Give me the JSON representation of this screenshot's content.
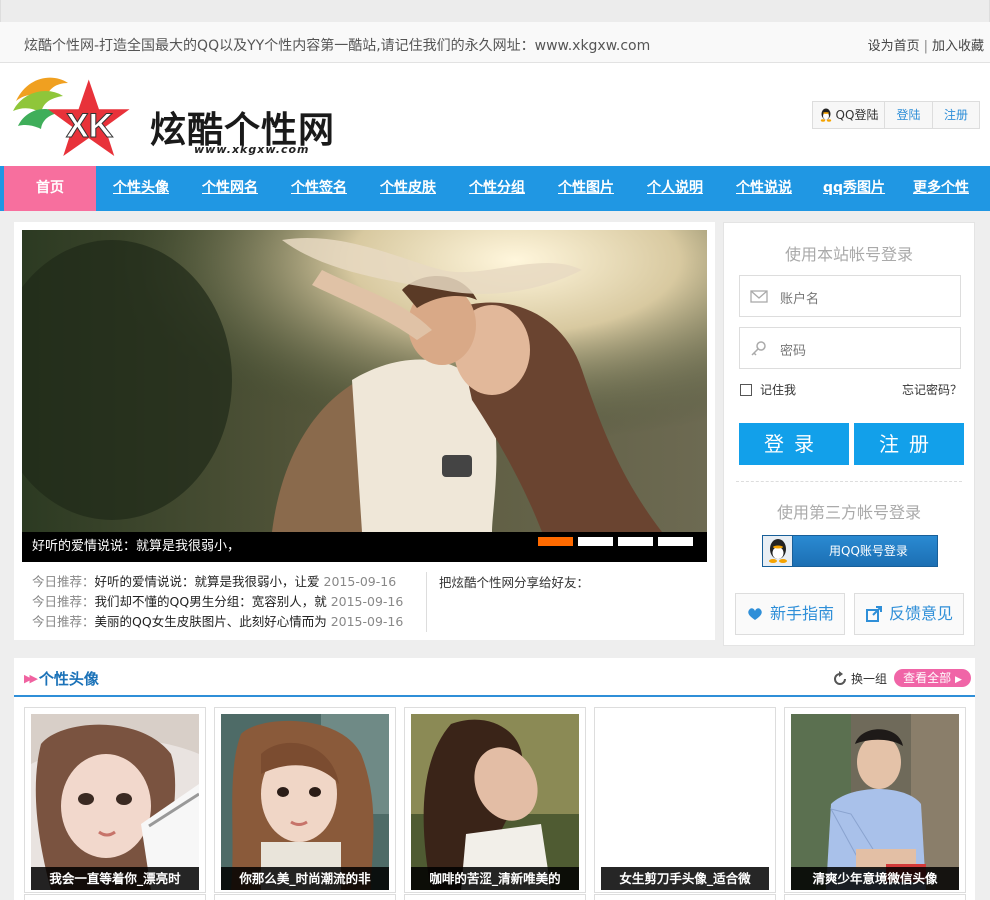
{
  "topbar": {
    "notice": "炫酷个性网-打造全国最大的QQ以及YY个性内容第一酷站,请记住我们的永久网址：www.xkgxw.com",
    "set_home": "设为首页",
    "separator": "|",
    "add_favorite": "加入收藏"
  },
  "header": {
    "logo_title": "炫酷个性网",
    "logo_url": "www.xkgxw.com",
    "qq_login": "QQ登陆",
    "login": "登陆",
    "register": "注册"
  },
  "nav": {
    "home": "首页",
    "items": [
      "个性头像",
      "个性网名",
      "个性签名",
      "个性皮肤",
      "个性分组",
      "个性图片",
      "个人说明",
      "个性说说",
      "qq秀图片",
      "更多个性"
    ]
  },
  "slider": {
    "caption": "好听的爱情说说：就算是我很弱小，",
    "active_index": 0,
    "count": 4
  },
  "recommend": {
    "label": "今日推荐：",
    "items": [
      {
        "title": "好听的爱情说说：就算是我很弱小，让爱",
        "date": "2015-09-16"
      },
      {
        "title": "我们却不懂的QQ男生分组：宽容别人，就",
        "date": "2015-09-16"
      },
      {
        "title": "美丽的QQ女生皮肤图片、此刻好心情而为",
        "date": "2015-09-16"
      }
    ],
    "share": "把炫酷个性网分享给好友："
  },
  "login_panel": {
    "title": "使用本站帐号登录",
    "username_placeholder": "账户名",
    "password_placeholder": "密码",
    "remember": "记住我",
    "forgot": "忘记密码？",
    "login_button": "登录",
    "register_button": "注册",
    "third_party_title": "使用第三方帐号登录",
    "qq_button": "用QQ账号登录",
    "guide": "新手指南",
    "feedback": "反馈意见"
  },
  "avatars_section": {
    "title": "个性头像",
    "swap": "换一组",
    "view_all": "查看全部",
    "cards": [
      {
        "caption": "我会一直等着你_漂亮时"
      },
      {
        "caption": "你那么美_时尚潮流的非"
      },
      {
        "caption": "咖啡的苦涩_清新唯美的"
      },
      {
        "caption": "女生剪刀手头像_适合微"
      },
      {
        "caption": "清爽少年意境微信头像"
      }
    ]
  },
  "colors": {
    "nav_blue": "#2097e3",
    "home_pink": "#f76f9e",
    "button_blue": "#12a0ea",
    "slider_active": "#ff6a00",
    "link_blue": "#2f8fd8"
  }
}
